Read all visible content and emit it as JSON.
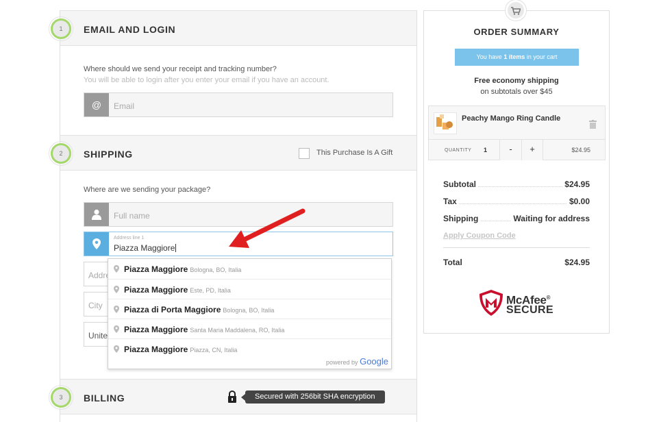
{
  "sections": {
    "email": {
      "step": "1",
      "title": "EMAIL AND LOGIN",
      "question": "Where should we send your receipt and tracking number?",
      "hint": "You will be able to login after you enter your email if you have an account.",
      "email_placeholder": "Email",
      "email_icon": "@"
    },
    "shipping": {
      "step": "2",
      "title": "SHIPPING",
      "gift_label": "This Purchase Is A Gift",
      "question": "Where are we sending your package?",
      "full_name_placeholder": "Full name",
      "address_small_label": "Address line 1",
      "address_value": "Piazza Maggiore",
      "address2_partial": "Addre",
      "city_partial": "City",
      "country_partial": "Unite"
    },
    "billing": {
      "step": "3",
      "title": "BILLING",
      "secure_text": "Secured with 256bit SHA encryption"
    }
  },
  "autocomplete": {
    "items": [
      {
        "main": "Piazza Maggiore",
        "secondary": "Bologna, BO, Italia"
      },
      {
        "main": "Piazza Maggiore",
        "secondary": "Este, PD, Italia"
      },
      {
        "main": "Piazza di Porta Maggiore",
        "secondary": "Bologna, BO, Italia"
      },
      {
        "main": "Piazza Maggiore",
        "secondary": "Santa Maria Maddalena, RO, Italia"
      },
      {
        "main": "Piazza Maggiore",
        "secondary": "Piazza, CN, Italia"
      }
    ],
    "powered_by": "powered by",
    "powered_brand": "Google"
  },
  "summary": {
    "title": "ORDER SUMMARY",
    "cart_count_prefix": "You have",
    "cart_count": "1 items",
    "cart_count_suffix": "in your cart",
    "shipping_line1": "Free economy shipping",
    "shipping_line2": "on subtotals over $45",
    "item": {
      "name": "Peachy Mango Ring Candle",
      "quantity_label": "QUANTITY",
      "quantity": "1",
      "minus": "-",
      "plus": "+",
      "price": "$24.95"
    },
    "subtotal_label": "Subtotal",
    "subtotal": "$24.95",
    "tax_label": "Tax",
    "tax": "$0.00",
    "shipping_label": "Shipping",
    "shipping": "Waiting for address",
    "coupon_label": "Apply Coupon Code",
    "total_label": "Total",
    "total": "$24.95",
    "badge_line1": "McAfee",
    "badge_reg": "®",
    "badge_line2": "SECURE"
  },
  "colors": {
    "accent_blue": "#5aaee0",
    "cart_banner": "#7bc3ea",
    "step_ring_green": "#a5d86a",
    "arrow_red": "#e02020",
    "mcafee_red": "#c8102e"
  }
}
